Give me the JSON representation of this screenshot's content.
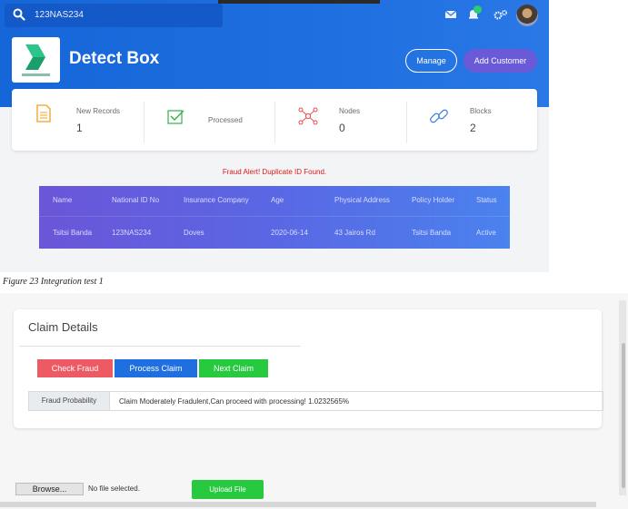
{
  "top": {
    "search_value": "123NAS234",
    "brand_name": "Detect Box",
    "logo_text": "DETECTBOX",
    "manage_label": "Manage",
    "add_customer_label": "Add Customer",
    "notification_count": "1"
  },
  "stats": [
    {
      "label": "New Records",
      "value": "1",
      "icon": "document-icon"
    },
    {
      "label": "Processed",
      "value": "",
      "icon": "check-square-icon"
    },
    {
      "label": "Nodes",
      "value": "0",
      "icon": "nodes-icon"
    },
    {
      "label": "Blocks",
      "value": "2",
      "icon": "link-icon"
    }
  ],
  "alert": "Fraud Alert! Duplicate ID Found.",
  "records": {
    "headers": [
      "Name",
      "National ID No",
      "Insurance Company",
      "Age",
      "Physical Address",
      "Policy Holder",
      "Status"
    ],
    "row": [
      "Tsitsi Banda",
      "123NAS234",
      "Doves",
      "2020-06-14",
      "43 Jairos Rd",
      "Tsitsi Banda",
      "Active"
    ]
  },
  "caption": "Figure 23 Integration test 1",
  "claim": {
    "title": "Claim Details",
    "check_fraud_label": "Check Fraud",
    "process_claim_label": "Process Claim",
    "next_claim_label": "Next Claim",
    "probability_label": "Fraud Probability",
    "probability_text": "Claim Moderately Fradulent,Can proceed with processing! 1.0232565%"
  },
  "upload": {
    "browse_label": "Browse...",
    "no_file_text": "No file selected.",
    "upload_label": "Upload File"
  },
  "colors": {
    "header_blue": "#1f6fe0",
    "add_customer": "#6a5ad8",
    "alert_red": "#d81a1a",
    "check_fraud": "#ee5a63",
    "process_claim": "#1f6fe0",
    "next_claim": "#27c93f"
  }
}
